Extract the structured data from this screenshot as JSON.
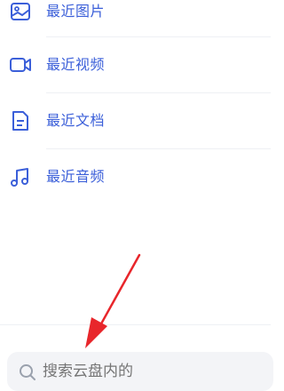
{
  "colors": {
    "accent": "#3b5fd9",
    "annotation_arrow": "#e8262b",
    "search_bg": "#f3f4f7",
    "placeholder": "#9aa1ad"
  },
  "menu": {
    "items": [
      {
        "label": "最近图片",
        "icon": "image-icon"
      },
      {
        "label": "最近视频",
        "icon": "video-camera-icon"
      },
      {
        "label": "最近文档",
        "icon": "document-icon"
      },
      {
        "label": "最近音频",
        "icon": "music-note-icon"
      }
    ]
  },
  "search": {
    "placeholder": "搜索云盘内的"
  }
}
